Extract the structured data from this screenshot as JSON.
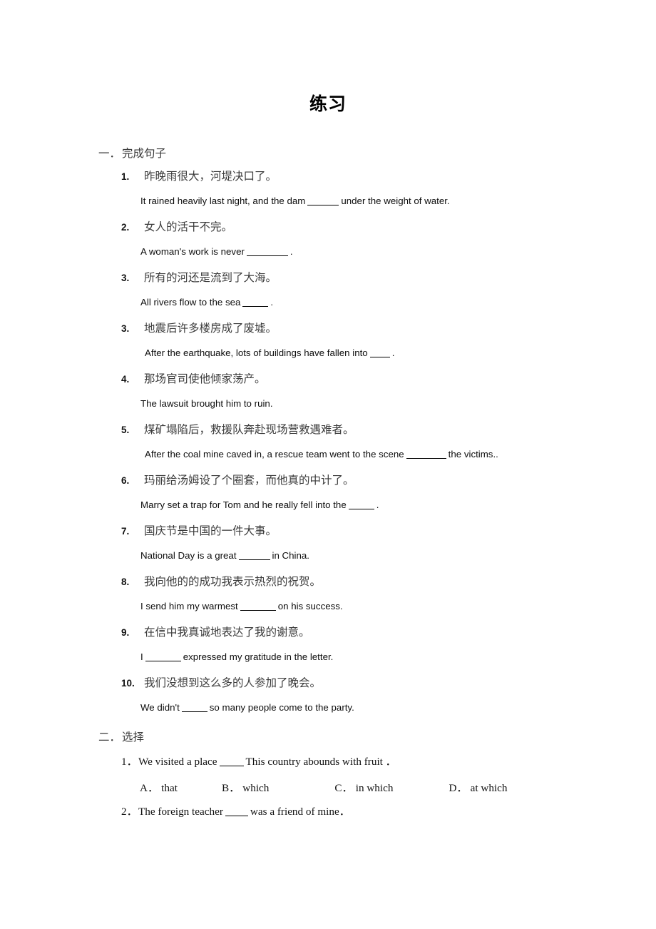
{
  "document": {
    "title": "练习"
  },
  "section_one": {
    "marker": "一．",
    "label": "完成句子",
    "items": [
      {
        "num": "1.",
        "chinese": "昨晚雨很大，河堤决口了。",
        "english_before": "It rained heavily last night, and the dam",
        "blank_width": 44,
        "english_after": "under the weight of water."
      },
      {
        "num": "2.",
        "chinese": "女人的活干不完。",
        "english_before": "A woman's work is never",
        "blank_width": 58,
        "english_after": "."
      },
      {
        "num": "3.",
        "chinese": "所有的河还是流到了大海。",
        "english_before": "All rivers flow to the sea",
        "blank_width": 36,
        "english_after": "."
      },
      {
        "num": "3.",
        "chinese": "地震后许多楼房成了废墟。",
        "english_before": "After the earthquake, lots of buildings have fallen into",
        "blank_width": 28,
        "english_after": "."
      },
      {
        "num": "4.",
        "chinese": "那场官司使他倾家荡产。",
        "english_before": "The lawsuit brought him to ruin.",
        "blank_width": 0,
        "english_after": ""
      },
      {
        "num": "5.",
        "chinese": "煤矿塌陷后，救援队奔赴现场营救遇难者。",
        "english_before": "After the coal mine caved in, a rescue team went to the scene",
        "blank_width": 56,
        "english_after": "the victims.."
      },
      {
        "num": "6.",
        "chinese": "玛丽给汤姆设了个圈套，而他真的中计了。",
        "english_before": "Marry set a trap for Tom and he really fell into the",
        "blank_width": 36,
        "english_after": "."
      },
      {
        "num": "7.",
        "chinese": "国庆节是中国的一件大事。",
        "english_before": "National Day is a great",
        "blank_width": 44,
        "english_after": "in China."
      },
      {
        "num": "8.",
        "chinese": "我向他的的成功我表示热烈的祝贺。",
        "english_before": "I send him my warmest",
        "blank_width": 50,
        "english_after": "on his success."
      },
      {
        "num": "9.",
        "chinese": "在信中我真诚地表达了我的谢意。",
        "english_before": "I",
        "blank_width": 50,
        "english_after": "expressed my gratitude in the letter."
      },
      {
        "num": "10.",
        "chinese": "我们没想到这么多的人参加了晚会。",
        "english_before": "We didn't",
        "blank_width": 36,
        "english_after": "so many people come to the party."
      }
    ]
  },
  "section_two": {
    "marker": "二．",
    "label": "选择",
    "items": [
      {
        "num": "1．",
        "text_before": "We visited a place",
        "blank_width": 34,
        "text_after": "This country abounds with fruit ．",
        "options": [
          {
            "letter": "A．",
            "text": "that"
          },
          {
            "letter": "B．",
            "text": "which"
          },
          {
            "letter": "C．",
            "text": "in which"
          },
          {
            "letter": "D．",
            "text": "at which"
          }
        ]
      },
      {
        "num": "2．",
        "text_before": "The foreign teacher",
        "blank_width": 32,
        "text_after": "was a friend of mine．",
        "options": []
      }
    ]
  }
}
